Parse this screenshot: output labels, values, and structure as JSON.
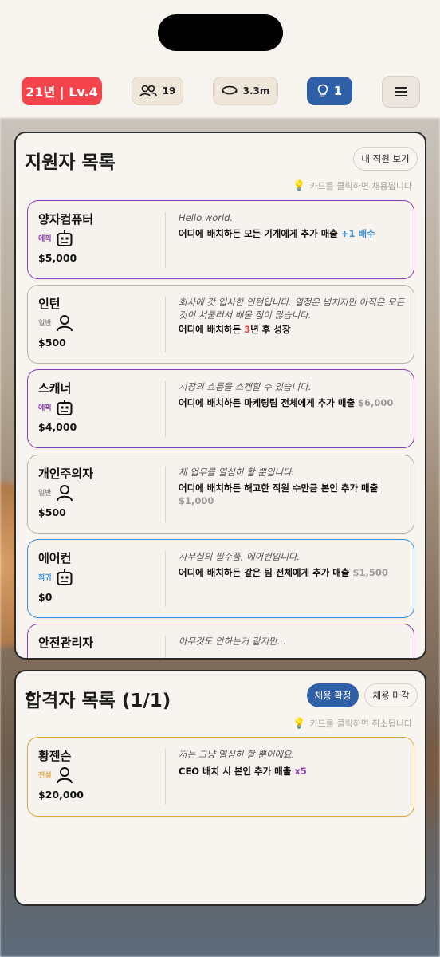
{
  "topbar": {
    "level": "21년 | Lv.4",
    "staff_count": "19",
    "money": "3.3m",
    "ideas": "1"
  },
  "applicants": {
    "title": "지원자 목록",
    "my_staff_button": "내 직원 보기",
    "hint": "카드를 클릭하면 채용됩니다",
    "cards": [
      {
        "name": "양자컴퓨터",
        "rarity": "에픽",
        "type_icon": "robot-icon",
        "price": "$5,000",
        "quote": "Hello world.",
        "effect_pre": "어디에 배치하든 모든 기계에게 추가 매출 ",
        "effect_hl": "+1 배수",
        "effect_post": ""
      },
      {
        "name": "인턴",
        "rarity": "일반",
        "type_icon": "person-icon",
        "price": "$500",
        "quote": "회사에 갓 입사한 인턴입니다. 열정은 넘치지만 아직은 모든 것이 서툴러서 배울 점이 많습니다.",
        "effect_pre": "어디에 배치하든 ",
        "effect_hl": "3",
        "effect_post": "년 후 성장"
      },
      {
        "name": "스캐너",
        "rarity": "에픽",
        "type_icon": "robot-icon",
        "price": "$4,000",
        "quote": "시장의 흐름을 스캔할 수 있습니다.",
        "effect_pre": "어디에 배치하든 마케팅팀 전체에게 추가 매출 ",
        "effect_hl": "$6,000",
        "effect_post": ""
      },
      {
        "name": "개인주의자",
        "rarity": "일반",
        "type_icon": "person-icon",
        "price": "$500",
        "quote": "제 업무를 열심히 할 뿐입니다.",
        "effect_pre": "어디에 배치하든 해고한 직원 수만큼 본인 추가 매출 ",
        "effect_hl": "$1,000",
        "effect_post": ""
      },
      {
        "name": "에어컨",
        "rarity": "희귀",
        "type_icon": "robot-icon",
        "price": "$0",
        "quote": "사무실의 필수품, 에어컨입니다.",
        "effect_pre": "어디에 배치하든 같은 팀 전체에게 추가 매출 ",
        "effect_hl": "$1,500",
        "effect_post": ""
      },
      {
        "name": "안전관리자",
        "rarity": "",
        "type_icon": "",
        "price": "",
        "quote": "아무것도 안하는거 같지만...",
        "effect_pre": "",
        "effect_hl": "",
        "effect_post": ""
      }
    ]
  },
  "hired": {
    "title": "합격자 목록 (1/1)",
    "confirm_button": "채용 확정",
    "close_button": "채용 마감",
    "hint": "카드를 클릭하면 취소됩니다",
    "cards": [
      {
        "name": "황젠슨",
        "rarity": "전설",
        "type_icon": "person-icon",
        "price": "$20,000",
        "quote": "저는 그냥 열심히 할 뿐이에요.",
        "effect_pre": "CEO 배치 시 본인 추가 매출 ",
        "effect_hl": "x5",
        "effect_post": ""
      }
    ]
  },
  "colors": {
    "level_badge": "#f2444a",
    "idea_badge": "#2f5fa6",
    "epic": "#8e3fb0",
    "rare": "#3a8fd6",
    "legend": "#e2a63a",
    "common": "#b9b3ac"
  }
}
